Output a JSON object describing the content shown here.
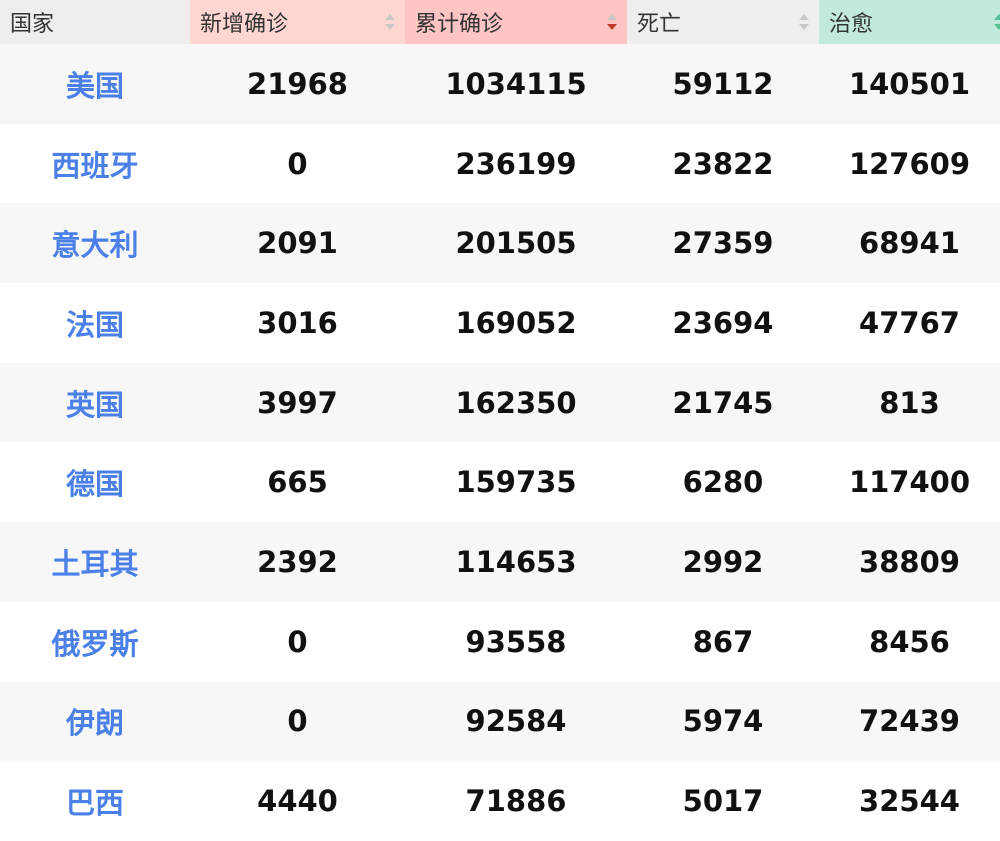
{
  "colors": {
    "header_country_bg": "#eeeeee",
    "header_new_bg": "#ffd6d1",
    "header_total_bg": "#ffc4c4",
    "header_death_bg": "#eeeeee",
    "header_cured_bg": "#c2eada",
    "country_text": "#4a80e8",
    "sort_active": "#c0392b",
    "sort_idle": "#c8c8c8"
  },
  "header": {
    "country": "国家",
    "new_confirmed": "新增确诊",
    "total_confirmed": "累计确诊",
    "deaths": "死亡",
    "cured": "治愈"
  },
  "rows": [
    {
      "country": "美国",
      "new": "21968",
      "total": "1034115",
      "deaths": "59112",
      "cured": "140501"
    },
    {
      "country": "西班牙",
      "new": "0",
      "total": "236199",
      "deaths": "23822",
      "cured": "127609"
    },
    {
      "country": "意大利",
      "new": "2091",
      "total": "201505",
      "deaths": "27359",
      "cured": "68941"
    },
    {
      "country": "法国",
      "new": "3016",
      "total": "169052",
      "deaths": "23694",
      "cured": "47767"
    },
    {
      "country": "英国",
      "new": "3997",
      "total": "162350",
      "deaths": "21745",
      "cured": "813"
    },
    {
      "country": "德国",
      "new": "665",
      "total": "159735",
      "deaths": "6280",
      "cured": "117400"
    },
    {
      "country": "土耳其",
      "new": "2392",
      "total": "114653",
      "deaths": "2992",
      "cured": "38809"
    },
    {
      "country": "俄罗斯",
      "new": "0",
      "total": "93558",
      "deaths": "867",
      "cured": "8456"
    },
    {
      "country": "伊朗",
      "new": "0",
      "total": "92584",
      "deaths": "5974",
      "cured": "72439"
    },
    {
      "country": "巴西",
      "new": "4440",
      "total": "71886",
      "deaths": "5017",
      "cured": "32544"
    }
  ]
}
